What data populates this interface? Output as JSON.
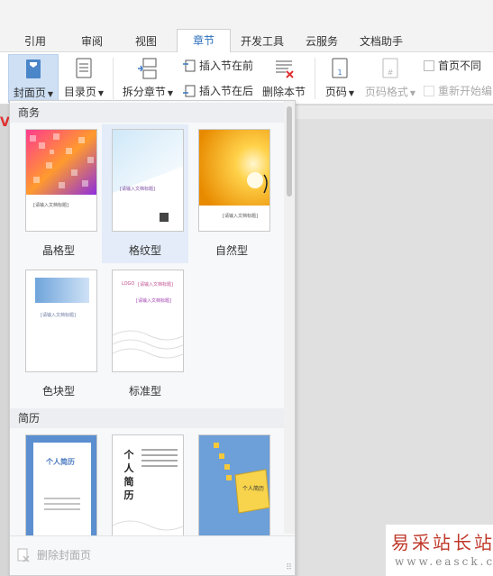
{
  "tabs": [
    {
      "label": "引用",
      "active": false
    },
    {
      "label": "审阅",
      "active": false
    },
    {
      "label": "视图",
      "active": false
    },
    {
      "label": "章节",
      "active": true
    },
    {
      "label": "开发工具",
      "active": false
    },
    {
      "label": "云服务",
      "active": false
    },
    {
      "label": "文档助手",
      "active": false
    }
  ],
  "ribbon": {
    "cover_page": "封面页",
    "toc_page": "目录页",
    "split_section": "拆分章节",
    "insert_before": "插入节在前",
    "insert_after": "插入节在后",
    "delete_section": "删除本节",
    "page_number": "页码",
    "page_number_format": "页码格式",
    "first_page_different": "首页不同",
    "restart_numbering": "重新开始编"
  },
  "dropdown": {
    "business_heading": "商务",
    "resume_heading": "简历",
    "business_items": [
      {
        "label": "晶格型"
      },
      {
        "label": "格纹型"
      },
      {
        "label": "自然型"
      },
      {
        "label": "色块型"
      },
      {
        "label": "标准型"
      }
    ],
    "thumb_texts": {
      "lattice": "[请输入文档标题]",
      "plaid": "[请输入文档标题]",
      "nature": "[请输入文档标题]",
      "colorblock": "[请输入文档标题]",
      "standard_logo": "LOGO",
      "standard_title": "[请输入文档标题]",
      "resume1": "个人简历",
      "resume2": "个人简历",
      "resume3": "个人简历"
    },
    "delete_cover": "删除封面页"
  },
  "watermark": {
    "site_name": "易采站长站",
    "url": "www.easck.com"
  },
  "colors": {
    "accent": "#2a6ebb",
    "selected_bg": "#e3ecf8",
    "pressed_bg": "#cfe0f5",
    "watermark_red": "#c0392b"
  }
}
